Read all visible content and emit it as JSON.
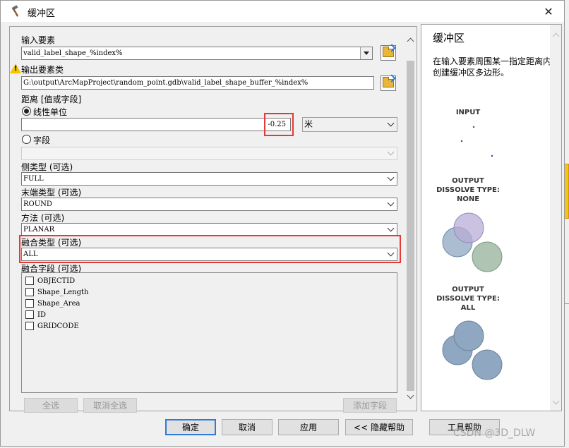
{
  "window": {
    "title": "缓冲区",
    "title_icon": "hammer-icon",
    "close_glyph": "✕"
  },
  "form": {
    "input_features": {
      "label": "输入要素",
      "value": "valid_label_shape_%index%"
    },
    "output_features": {
      "label": "输出要素类",
      "value": "G:\\output\\ArcMapProject\\random_point.gdb\\valid_label_shape_buffer_%index%",
      "warning_icon": "warning-icon"
    },
    "distance": {
      "label": "距离 [值或字段]",
      "linear_unit_label": "线性单位",
      "linear_value": "-0.25",
      "unit": "米",
      "field_label": "字段",
      "field_value": ""
    },
    "side_type": {
      "label": "侧类型 (可选)",
      "value": "FULL"
    },
    "end_type": {
      "label": "末端类型 (可选)",
      "value": "ROUND"
    },
    "method": {
      "label": "方法 (可选)",
      "value": "PLANAR"
    },
    "dissolve_type": {
      "label": "融合类型 (可选)",
      "value": "ALL"
    },
    "dissolve_fields": {
      "label": "融合字段 (可选)",
      "items": [
        "OBJECTID",
        "Shape_Length",
        "Shape_Area",
        "ID",
        "GRIDCODE"
      ]
    },
    "select_all": "全选",
    "clear_all": "取消全选",
    "add_field": "添加字段"
  },
  "help": {
    "title": "缓冲区",
    "description": "在输入要素周围某一指定距离内创建缓冲区多边形。",
    "diagram_input": "INPUT",
    "diagram_none_l1": "OUTPUT",
    "diagram_none_l2": "DISSOLVE TYPE:",
    "diagram_none_l3": "NONE",
    "diagram_all_l1": "OUTPUT",
    "diagram_all_l2": "DISSOLVE TYPE:",
    "diagram_all_l3": "ALL"
  },
  "buttons": {
    "ok": "确定",
    "cancel": "取消",
    "apply": "应用",
    "hide_help": "<< 隐藏帮助",
    "tool_help": "工具帮助"
  },
  "watermark": "CSDN @3D_DLW",
  "colors": {
    "highlight": "#e53935",
    "circle_purple": "#b8aed6",
    "circle_blue": "#8fa7c0",
    "circle_green": "#9bb5a0"
  }
}
